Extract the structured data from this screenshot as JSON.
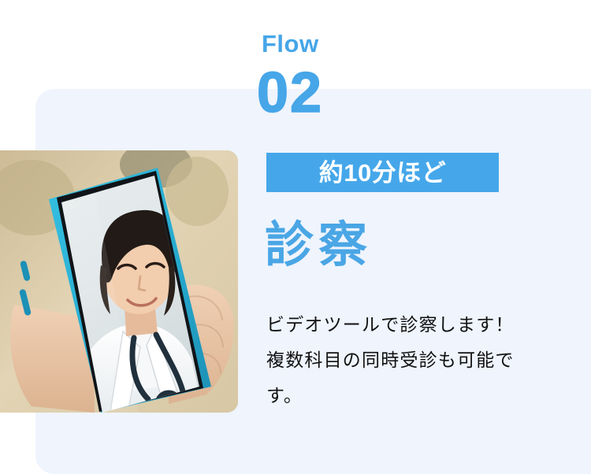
{
  "theme": {
    "page_background": "#ffffff",
    "card_background": "#eff4fd",
    "accent_blue": "#46a6e8",
    "badge_background": "#45a7ea",
    "badge_text_color": "#ffffff",
    "heading_color": "#4aa6e5",
    "body_text_color": "#111111"
  },
  "flow": {
    "eyebrow": "Flow",
    "step_number": "02"
  },
  "badge": {
    "label": "約10分ほど"
  },
  "section": {
    "heading": "診察",
    "body": "ビデオツールで診察します！複数科目の同時受診も可能です。"
  },
  "photo": {
    "alt": "スマートフォンを持つ手と画面に映る白衣の女性医師",
    "phone_case_color": "#2fb6d8",
    "background_color": "#d9c9a8"
  }
}
